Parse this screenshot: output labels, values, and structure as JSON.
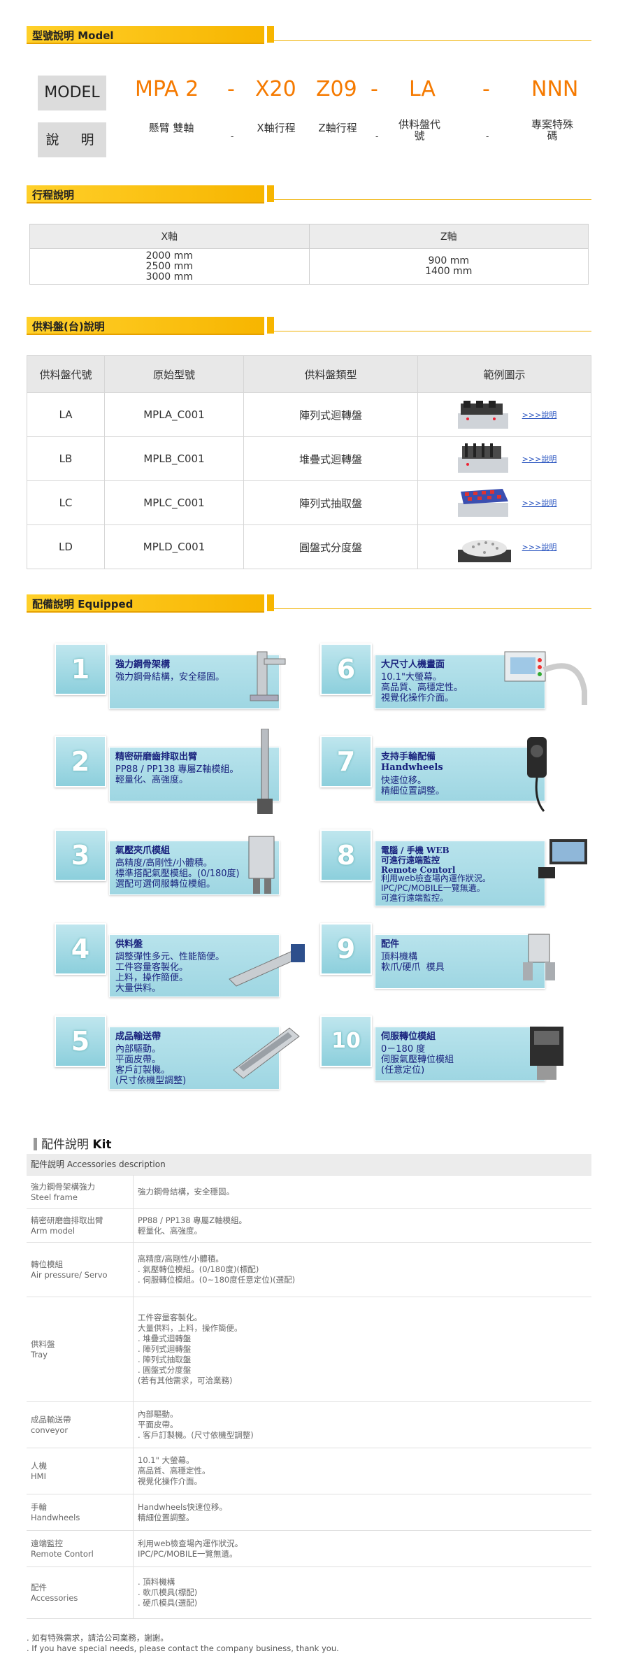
{
  "model_section": {
    "title": "型號說明 Model",
    "label_model": "MODEL",
    "label_desc": "說　明",
    "codes": [
      "MPA 2",
      "-",
      "X20",
      "Z09",
      "-",
      "LA",
      "-",
      "NNN"
    ],
    "descs": [
      "懸臂 雙軸",
      "-",
      "X軸行程",
      "Z軸行程",
      "-",
      "供料盤代號",
      "-",
      "專案特殊碼"
    ]
  },
  "stroke_section": {
    "title": "行程說明",
    "headers": [
      "X軸",
      "Z軸"
    ],
    "x_values": "2000 mm\n2500 mm\n3000 mm",
    "z_values": "900 mm\n1400 mm"
  },
  "tray_section": {
    "title": "供料盤(台)說明",
    "headers": [
      "供料盤代號",
      "原始型號",
      "供料盤類型",
      "範例圖示"
    ],
    "link_text": ">>>說明",
    "rows": [
      {
        "code": "LA",
        "model": "MPLA_C001",
        "type": "陣列式迴轉盤"
      },
      {
        "code": "LB",
        "model": "MPLB_C001",
        "type": "堆疊式迴轉盤"
      },
      {
        "code": "LC",
        "model": "MPLC_C001",
        "type": "陣列式抽取盤"
      },
      {
        "code": "LD",
        "model": "MPLD_C001",
        "type": "圓盤式分度盤"
      }
    ]
  },
  "equipped_section": {
    "title": "配備說明  Equipped",
    "cards": [
      {
        "num": "1",
        "title": "強力鋼骨架構",
        "body": "強力鋼骨結構，安全穩固。"
      },
      {
        "num": "2",
        "title": "精密研磨齒排取出臂",
        "body": "PP88 / PP138 專屬Z軸模組。\n輕量化、高強度。"
      },
      {
        "num": "3",
        "title": "氣壓夾爪模組",
        "body": "高精度/高剛性/小體積。\n標準搭配氣壓模組。(0/180度)\n選配可選伺服轉位模組。"
      },
      {
        "num": "4",
        "title": "供料盤",
        "body": "調整彈性多元、性能簡便。\n工件容量客製化。\n上料，操作簡便。\n大量供料。"
      },
      {
        "num": "5",
        "title": "成品輸送帶",
        "body": "內部驅動。\n平面皮帶。\n客戶訂製機。\n(尺寸依機型調整)"
      },
      {
        "num": "6",
        "title": "大尺寸人機畫面",
        "body": "10.1\"大螢幕。\n高品質、高穩定性。\n視覺化操作介面。"
      },
      {
        "num": "7",
        "title": "支持手輪配備\nHandwheels",
        "body": "快速位移。\n精細位置調整。"
      },
      {
        "num": "8",
        "title": "電腦 / 手機 WEB\n可進行遠端監控\nRemote Contorl",
        "body": "利用web檢查場內運作狀況。\nIPC/PC/MOBILE一覽無遺。\n可進行遠端監控。"
      },
      {
        "num": "9",
        "title": "配件",
        "body": "頂料機構\n軟爪/硬爪  模具"
      },
      {
        "num": "10",
        "title": "伺服轉位模組",
        "body": "0－180 度\n伺服氣壓轉位模組\n(任意定位)"
      }
    ]
  },
  "kit_section": {
    "title_cn": "配件說明",
    "title_en": "Kit",
    "header": "配件說明 Accessories description",
    "rows": [
      {
        "k": "強力鋼骨架構強力\nSteel frame",
        "v": "強力鋼骨結構，安全穩固。"
      },
      {
        "k": "精密研磨齒排取出臂\nArm model",
        "v": "PP88 / PP138 專屬Z軸模組。\n輕量化、高強度。"
      },
      {
        "k": "轉位模組\nAir pressure/ Servo",
        "v": "高精度/高剛性/小體積。\n. 氣壓轉位模組。(0/180度)(標配)\n. 伺服轉位模組。(0~180度任意定位)(選配)"
      },
      {
        "k": "供料盤\nTray",
        "v": "工件容量客製化。\n大量供料，上料，操作簡便。\n. 堆疊式迴轉盤\n. 陣列式迴轉盤\n. 陣列式抽取盤\n. 圓盤式分度盤\n(若有其他需求，可洽業務)"
      },
      {
        "k": "成品輸送帶\nconveyor",
        "v": "內部驅動。\n平面皮帶。\n. 客戶訂製機。(尺寸依機型調整)"
      },
      {
        "k": "人機\nHMI",
        "v": "10.1\" 大螢幕。\n高品質、高穩定性。\n視覺化操作介面。"
      },
      {
        "k": "手輪\nHandwheels",
        "v": "Handwheels快速位移。\n精細位置調整。"
      },
      {
        "k": "遠端監控\nRemote Contorl",
        "v": "利用web檢查場內運作狀況。\nIPC/PC/MOBILE一覽無遺。"
      },
      {
        "k": "配件\nAccessories",
        "v": ". 頂料機構\n. 軟爪模具(標配)\n. 硬爪模具(選配)"
      }
    ]
  },
  "footer": {
    "line1": ". 如有特殊需求，請洽公司業務，謝謝。",
    "line2": ". If you have special needs, please contact the company business, thank you."
  }
}
